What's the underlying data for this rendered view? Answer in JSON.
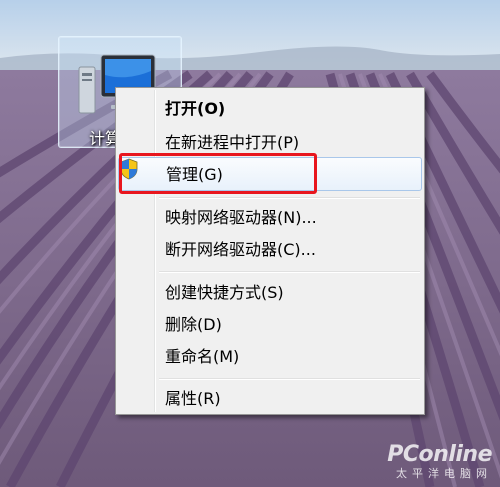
{
  "desktop": {
    "icon": {
      "name": "computer-icon",
      "label": "计算机"
    }
  },
  "context_menu": {
    "items": [
      {
        "label": "打开(O)",
        "bold": true
      },
      {
        "label": "在新进程中打开(P)"
      },
      {
        "label": "管理(G)",
        "icon": "uac-shield-icon",
        "highlighted": true
      },
      {
        "label": "映射网络驱动器(N)..."
      },
      {
        "label": "断开网络驱动器(C)..."
      },
      {
        "label": "创建快捷方式(S)"
      },
      {
        "label": "删除(D)"
      },
      {
        "label": "重命名(M)"
      },
      {
        "label": "属性(R)"
      }
    ]
  },
  "watermark": {
    "logo": "PConline",
    "sub": "太平洋电脑网"
  },
  "colors": {
    "highlight_box": "#e8161e",
    "menu_bg": "#f0f0f0",
    "hover_border": "#a9c7ea"
  }
}
